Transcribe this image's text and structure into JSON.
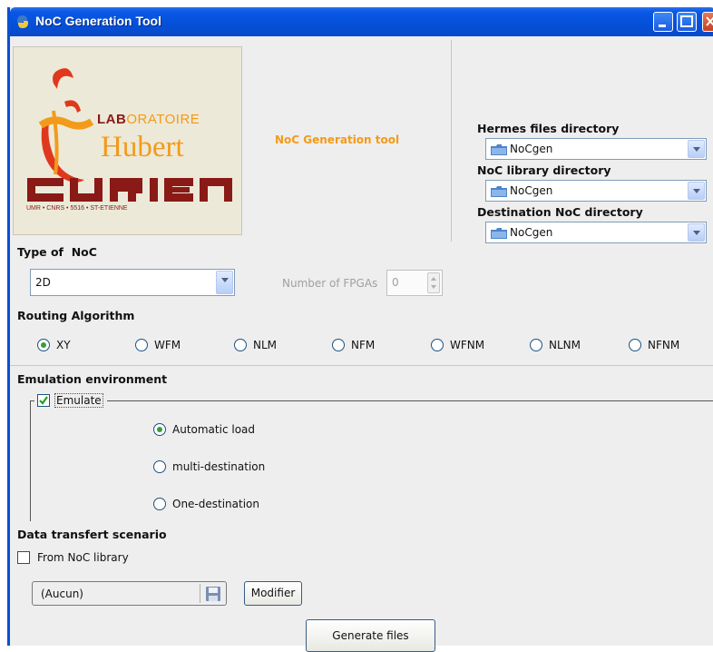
{
  "window": {
    "title": "NoC Generation Tool"
  },
  "logo": {
    "lab_prefix": "LAB",
    "lab_suffix": "ORATOIRE",
    "hubert": "Hubert",
    "curien": "CURIEN",
    "subtitle": "UMR • CNRS • 5516 • ST-ETIENNE"
  },
  "center_title": "NoC Generation tool",
  "directories": [
    {
      "label": "Hermes files directory",
      "value": "NoCgen"
    },
    {
      "label": "NoC library directory",
      "value": "NoCgen"
    },
    {
      "label": "Destination NoC directory",
      "value": "NoCgen"
    }
  ],
  "noc_type": {
    "label": "Type of  NoC",
    "value": "2D"
  },
  "fpgas": {
    "label": "Number of FPGAs",
    "value": "0"
  },
  "routing": {
    "label": "Routing Algorithm",
    "options": [
      "XY",
      "WFM",
      "NLM",
      "NFM",
      "WFNM",
      "NLNM",
      "NFNM"
    ],
    "selected": "XY"
  },
  "emulation": {
    "label": "Emulation environment",
    "checkbox_label": "Emulate",
    "checked": true,
    "options": [
      "Automatic load",
      "multi-destination",
      "One-destination"
    ],
    "selected": "Automatic load"
  },
  "scenario": {
    "label": "Data transfert scenario",
    "checkbox_label": "From NoC library",
    "checked": false,
    "file_value": "(Aucun)",
    "modify_button": "Modifier"
  },
  "generate_button": "Generate files",
  "colors": {
    "title_blue": "#0450d8",
    "orange": "#f39a1a",
    "maroon": "#8a1a16",
    "radio_green": "#3a9b3a"
  }
}
